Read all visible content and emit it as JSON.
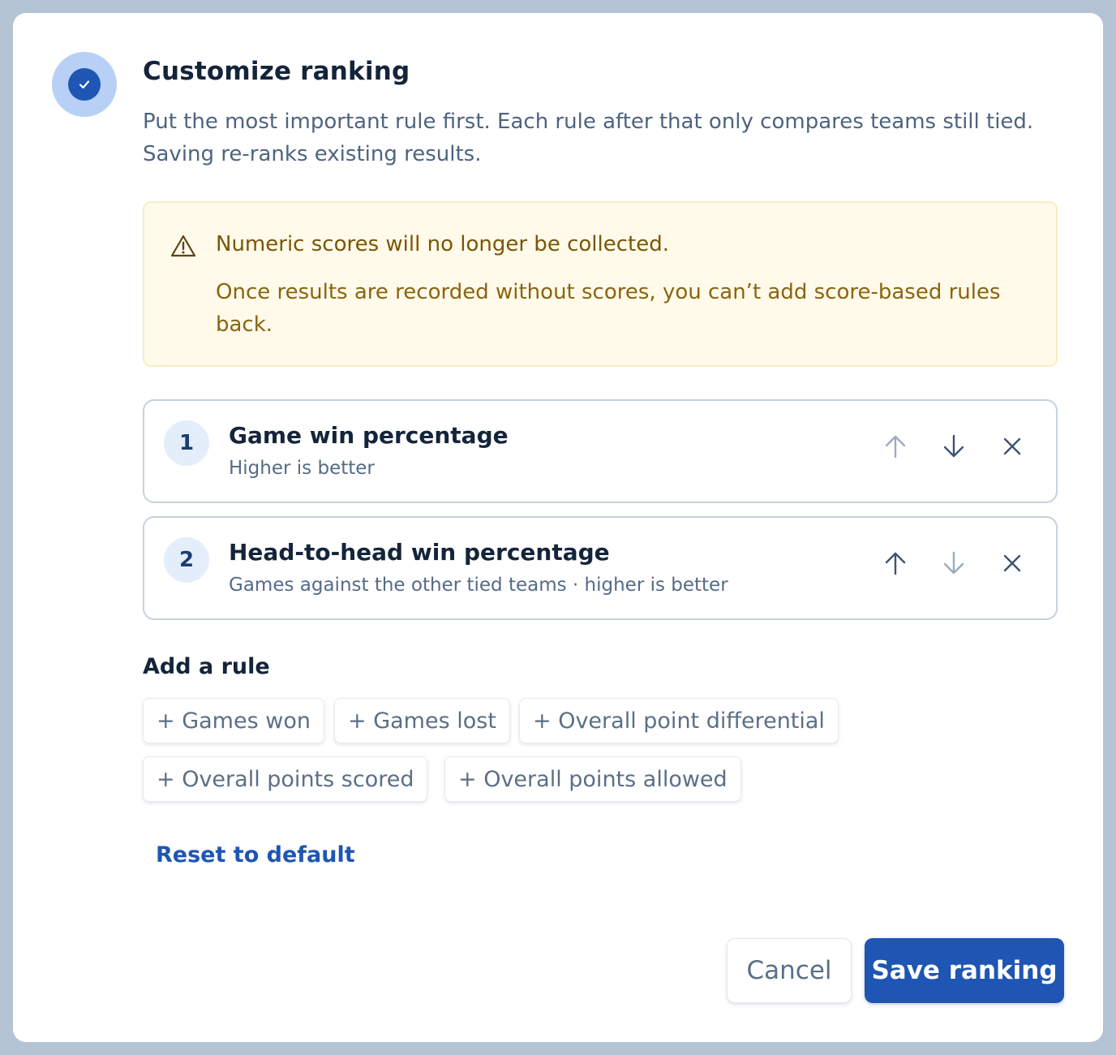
{
  "dialog": {
    "title": "Customize ranking",
    "subtitle": "Put the most important rule first. Each rule after that only compares teams still tied. Saving re-ranks existing results."
  },
  "warning": {
    "title": "Numeric scores will no longer be collected.",
    "body": "Once results are recorded without scores, you can’t add score-based rules back."
  },
  "rules": [
    {
      "number": "1",
      "name": "Game win percentage",
      "description": "Higher is better"
    },
    {
      "number": "2",
      "name": "Head-to-head win percentage",
      "description": "Games against the other tied teams · higher is better"
    }
  ],
  "add_rule": {
    "label": "Add a rule",
    "options": [
      "+ Games won",
      "+ Games lost",
      "+ Overall point differential",
      "+ Overall points scored",
      "+ Overall points allowed"
    ]
  },
  "reset_label": "Reset to default",
  "footer": {
    "cancel_label": "Cancel",
    "save_label": "Save ranking"
  },
  "colors": {
    "accent": "#1f56b3",
    "warning_bg": "#fffaea",
    "warning_text": "#7a5606"
  },
  "icons": {
    "status": "check-icon",
    "warning": "warning-triangle-icon",
    "move_up": "arrow-up-icon",
    "move_down": "arrow-down-icon",
    "remove": "close-icon"
  }
}
